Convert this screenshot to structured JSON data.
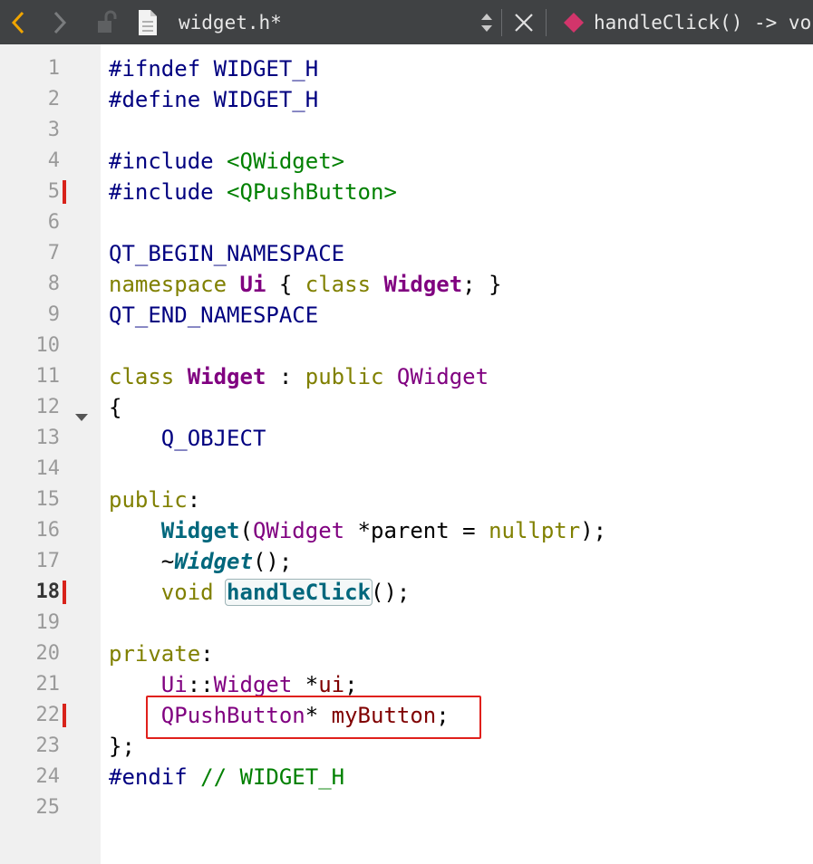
{
  "toolbar": {
    "back_icon": "chevron-left-icon",
    "forward_icon": "chevron-right-icon",
    "lock_icon": "unlocked-icon",
    "file_icon": "document-icon",
    "file_name": "widget.h*",
    "close_icon": "close-icon",
    "symbol_icon": "function-diamond-icon",
    "symbol_name": "handleClick() -> void",
    "accent_color": "#f0a500",
    "symbol_color": "#d2356b"
  },
  "editor": {
    "current_line": 18,
    "changed_lines": [
      5,
      18,
      22
    ],
    "folded_line": 11,
    "line_numbers": [
      "1",
      "2",
      "3",
      "4",
      "5",
      "6",
      "7",
      "8",
      "9",
      "10",
      "11",
      "12",
      "13",
      "14",
      "15",
      "16",
      "17",
      "18",
      "19",
      "20",
      "21",
      "22",
      "23",
      "24",
      "25"
    ],
    "lines": [
      [
        [
          "#ifndef WIDGET_H",
          "t-preproc"
        ]
      ],
      [
        [
          "#define WIDGET_H",
          "t-preproc"
        ]
      ],
      [],
      [
        [
          "#include ",
          "t-preproc"
        ],
        [
          "<QWidget>",
          "t-string"
        ]
      ],
      [
        [
          "#include ",
          "t-preproc"
        ],
        [
          "<QPushButton>",
          "t-string"
        ]
      ],
      [],
      [
        [
          "QT_BEGIN_NAMESPACE",
          "t-macro"
        ]
      ],
      [
        [
          "namespace ",
          "t-keyword"
        ],
        [
          "Ui",
          "t-classdef"
        ],
        [
          " { ",
          "t-punct"
        ],
        [
          "class ",
          "t-keyword"
        ],
        [
          "Widget",
          "t-classdef"
        ],
        [
          "; }",
          "t-punct"
        ]
      ],
      [
        [
          "QT_END_NAMESPACE",
          "t-macro"
        ]
      ],
      [],
      [
        [
          "class ",
          "t-keyword"
        ],
        [
          "Widget",
          "t-classdef"
        ],
        [
          " : ",
          "t-punct"
        ],
        [
          "public ",
          "t-keyword"
        ],
        [
          "QWidget",
          "t-class"
        ]
      ],
      [
        [
          "{",
          "t-punct"
        ]
      ],
      [
        [
          "    ",
          "t-punct"
        ],
        [
          "Q_OBJECT",
          "t-macro"
        ]
      ],
      [],
      [
        [
          "public",
          "t-keyword"
        ],
        [
          ":",
          "t-punct"
        ]
      ],
      [
        [
          "    ",
          "t-punct"
        ],
        [
          "Widget",
          "t-func"
        ],
        [
          "(",
          "t-punct"
        ],
        [
          "QWidget",
          "t-class"
        ],
        [
          " *parent = ",
          "t-punct"
        ],
        [
          "nullptr",
          "t-keyword"
        ],
        [
          ");",
          "t-punct"
        ]
      ],
      [
        [
          "    ~",
          "t-punct"
        ],
        [
          "Widget",
          "t-func-it"
        ],
        [
          "();",
          "t-punct"
        ]
      ],
      [
        [
          "    ",
          "t-punct"
        ],
        [
          "void ",
          "t-keyword"
        ],
        [
          "handleClick",
          "hl-func"
        ],
        [
          "();",
          "t-punct"
        ]
      ],
      [],
      [
        [
          "private",
          "t-keyword"
        ],
        [
          ":",
          "t-punct"
        ]
      ],
      [
        [
          "    ",
          "t-punct"
        ],
        [
          "Ui",
          "t-class"
        ],
        [
          "::",
          "t-punct"
        ],
        [
          "Widget",
          "t-class"
        ],
        [
          " *",
          "t-punct"
        ],
        [
          "ui",
          "t-field"
        ],
        [
          ";",
          "t-punct"
        ]
      ],
      [
        [
          "    ",
          "t-punct"
        ],
        [
          "QPushButton",
          "t-class"
        ],
        [
          "* ",
          "t-punct"
        ],
        [
          "myButton",
          "t-field"
        ],
        [
          ";",
          "t-punct"
        ]
      ],
      [
        [
          "};",
          "t-punct"
        ]
      ],
      [
        [
          "#endif ",
          "t-preproc"
        ],
        [
          "// WIDGET_H",
          "t-comment"
        ]
      ],
      []
    ]
  },
  "annotation": {
    "color": "#e0201b"
  }
}
